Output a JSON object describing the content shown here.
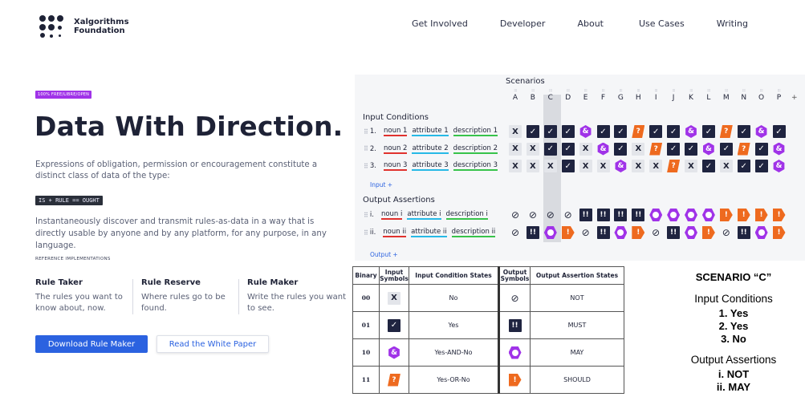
{
  "brand": {
    "name_line1": "Xalgorithms",
    "name_line2": "Foundation"
  },
  "nav": [
    "Get Involved",
    "Developer",
    "About",
    "Use Cases",
    "Writing"
  ],
  "hero": {
    "badge": "100% FREE/LIBRE/OPEN",
    "title": "Data With Direction.",
    "description": "Expressions of obligation, permission or encouragement constitute a distinct class of data of the type:",
    "code": "IS + RULE == OUGHT",
    "description2": "Instantaneously discover and transmit rules-as-data in a way that is directly usable by anyone and by any platform, for any purpose, in any language.",
    "ref_label": "REFERENCE IMPLEMENTATIONS",
    "implementations": [
      {
        "title": "Rule Taker",
        "desc": "The rules you want to know about, now."
      },
      {
        "title": "Rule Reserve",
        "desc": "Where rules go to be found."
      },
      {
        "title": "Rule Maker",
        "desc": "Write the rules you want to see."
      }
    ],
    "primary_button": "Download Rule Maker",
    "secondary_button": "Read the White Paper"
  },
  "scenarios": {
    "title": "Scenarios",
    "columns": [
      "A",
      "B",
      "C",
      "D",
      "E",
      "F",
      "G",
      "H",
      "I",
      "J",
      "K",
      "L",
      "M",
      "N",
      "O",
      "P"
    ],
    "add_column": "+",
    "input_label": "Input Conditions",
    "output_label": "Output Assertions",
    "input_rows": [
      {
        "num": "1.",
        "noun": "noun 1",
        "attribute": "attribute 1",
        "description": "description 1",
        "cells": [
          "X",
          "check",
          "check",
          "check",
          "amp",
          "check",
          "check",
          "q",
          "check",
          "check",
          "amp",
          "check",
          "q",
          "check",
          "amp",
          "check"
        ]
      },
      {
        "num": "2.",
        "noun": "noun 2",
        "attribute": "attribute 2",
        "description": "description 2",
        "cells": [
          "X",
          "X",
          "check",
          "check",
          "X",
          "amp",
          "check",
          "X",
          "q",
          "check",
          "check",
          "amp",
          "check",
          "q",
          "check",
          "amp"
        ]
      },
      {
        "num": "3.",
        "noun": "noun 3",
        "attribute": "attribute 3",
        "description": "description 3",
        "cells": [
          "X",
          "X",
          "X",
          "check",
          "X",
          "X",
          "amp",
          "X",
          "X",
          "q",
          "X",
          "check",
          "X",
          "check",
          "check",
          "amp"
        ]
      }
    ],
    "output_rows": [
      {
        "num": "i.",
        "noun": "noun i",
        "attribute": "attribute i",
        "description": "description i",
        "cells": [
          "not",
          "not",
          "not",
          "not",
          "must",
          "must",
          "must",
          "must",
          "may",
          "may",
          "may",
          "may",
          "sh",
          "sh",
          "sh",
          "sh"
        ]
      },
      {
        "num": "ii.",
        "noun": "noun ii",
        "attribute": "attribute ii",
        "description": "description ii",
        "cells": [
          "not",
          "must",
          "may",
          "sh",
          "not",
          "must",
          "may",
          "sh",
          "not",
          "must",
          "may",
          "sh",
          "not",
          "must",
          "may",
          "sh"
        ]
      }
    ],
    "input_add": "Input  +",
    "output_add": "Output  +",
    "glyphs": {
      "X": "X",
      "check": "✓",
      "amp": "&",
      "q": "?",
      "not": "⊘",
      "must": "!!",
      "may": "",
      "sh": "!"
    }
  },
  "legend": {
    "headers": [
      "Binary",
      "Input Symbols",
      "Input Condition States",
      "Output Symbols",
      "Output Assertion States"
    ],
    "rows": [
      {
        "binary": "00",
        "in_sym": "X",
        "in_state": "No",
        "out_sym": "not",
        "out_state": "NOT"
      },
      {
        "binary": "01",
        "in_sym": "check",
        "in_state": "Yes",
        "out_sym": "must",
        "out_state": "MUST"
      },
      {
        "binary": "10",
        "in_sym": "amp",
        "in_state": "Yes-AND-No",
        "out_sym": "may",
        "out_state": "MAY"
      },
      {
        "binary": "11",
        "in_sym": "q",
        "in_state": "Yes-OR-No",
        "out_sym": "sh",
        "out_state": "SHOULD"
      }
    ]
  },
  "explanation": {
    "title": "SCENARIO “C”",
    "input_heading": "Input Conditions",
    "inputs": [
      "1. Yes",
      "2. Yes",
      "3.  No"
    ],
    "output_heading": "Output Assertions",
    "outputs": [
      "i.  NOT",
      "ii. MAY"
    ]
  },
  "colors": {
    "accent": "#2b62e0",
    "purple": "#a033e8",
    "orange": "#ee6a1f",
    "navy": "#1f2440"
  }
}
